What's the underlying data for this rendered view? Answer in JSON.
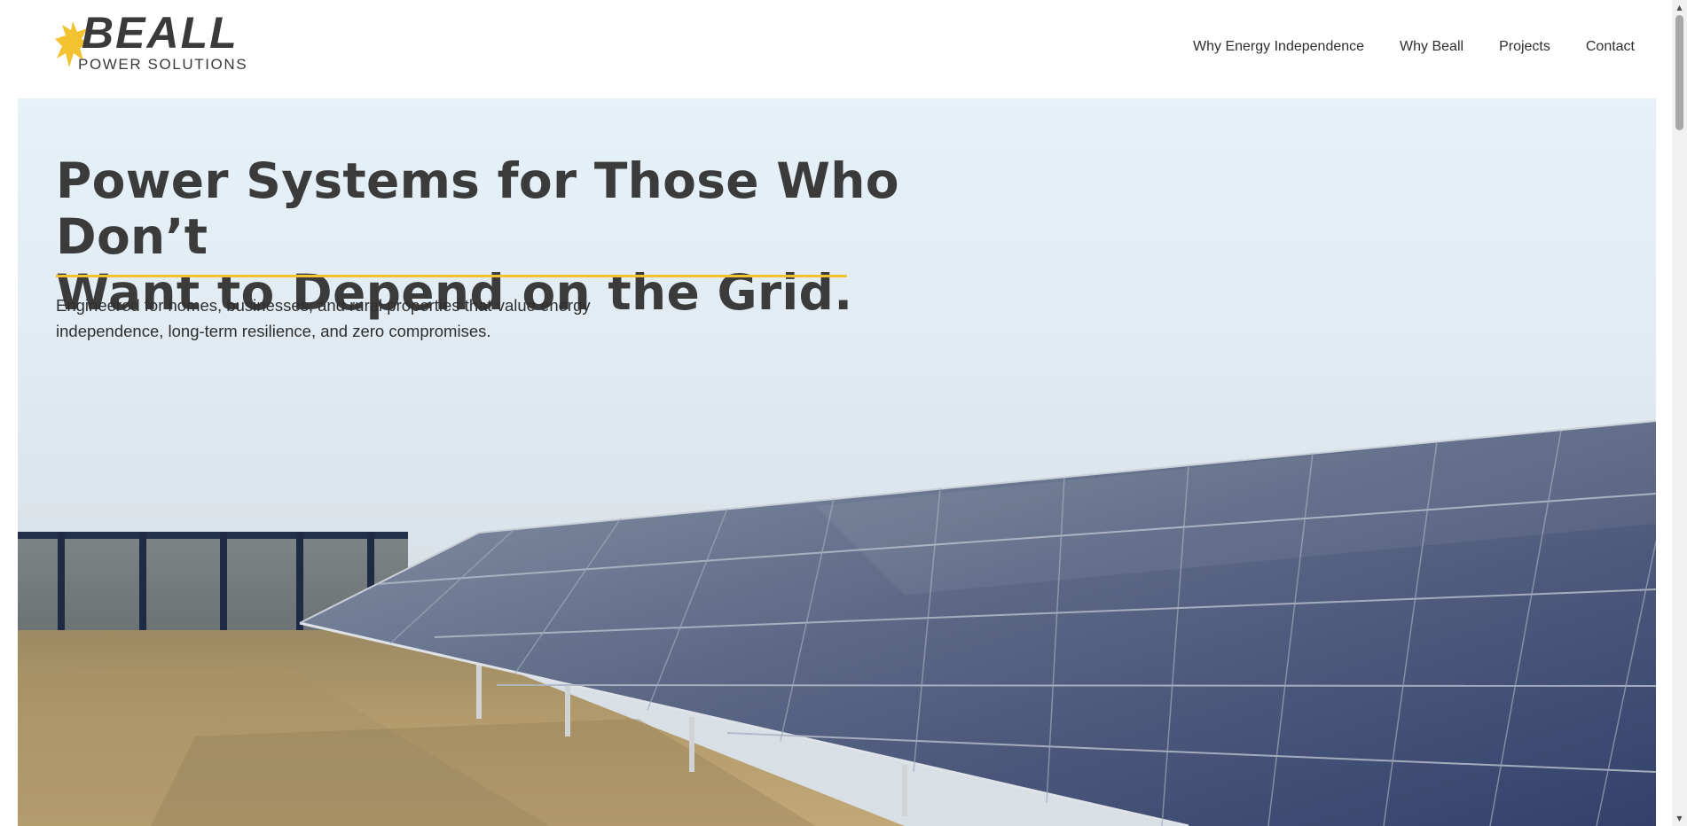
{
  "brand": {
    "name": "BEALL",
    "tagline": "POWER SOLUTIONS",
    "accent_color": "#f2c230",
    "text_color": "#3a3a3a"
  },
  "nav": {
    "items": [
      {
        "label": "Why Energy Independence"
      },
      {
        "label": "Why Beall"
      },
      {
        "label": "Projects"
      },
      {
        "label": "Contact"
      }
    ]
  },
  "hero": {
    "title_line1": "Power Systems for Those Who Don’t",
    "title_line2": "Want to Depend on the Grid.",
    "subtitle_line1": "Engineered for homes, businesses, and rural properties that value energy",
    "subtitle_line2": "independence, long-term resilience, and zero compromises.",
    "background_image": "solar-panel-array-photo"
  },
  "icons": {
    "logo_mark": "sun-burst-icon",
    "scroll_up": "triangle-up-icon",
    "scroll_down": "triangle-down-icon"
  }
}
